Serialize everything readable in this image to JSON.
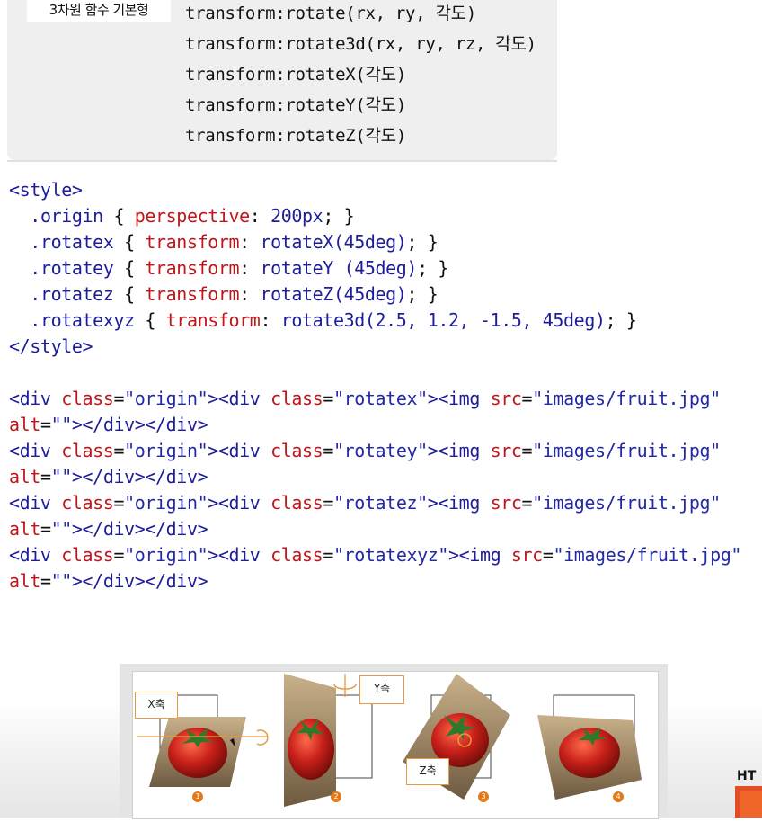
{
  "function_table": {
    "label": "3차원 함수 기본형",
    "lines": [
      "transform:rotate(rx, ry, 각도)",
      "transform:rotate3d(rx, ry, rz, 각도)",
      "transform:rotateX(각도)",
      "transform:rotateY(각도)",
      "transform:rotateZ(각도)"
    ]
  },
  "style_block": {
    "open": "<style>",
    "close": "</style>",
    "rules": [
      {
        "selector": ".origin",
        "property": "perspective",
        "value": "200px",
        "rest": "; }"
      },
      {
        "selector": ".rotatex",
        "property": "transform",
        "value": "rotateX(45deg)",
        "rest": "; }"
      },
      {
        "selector": ".rotatey",
        "property": "transform",
        "value": "rotateY (45deg)",
        "rest": "; }"
      },
      {
        "selector": ".rotatez",
        "property": "transform",
        "value": "rotateZ(45deg)",
        "rest": "; }"
      },
      {
        "selector": ".rotatexyz",
        "property": "transform",
        "value": "rotate3d(2.5, 1.2, -1.5, 45deg)",
        "rest": "; }"
      }
    ]
  },
  "html_block": {
    "divs": [
      {
        "outer_class": "\"origin\"",
        "inner_class": "\"rotatex\"",
        "src": "\"images/fruit.jpg\"",
        "alt": "\"\""
      },
      {
        "outer_class": "\"origin\"",
        "inner_class": "\"rotatey\"",
        "src": "\"images/fruit.jpg\"",
        "alt": "\"\""
      },
      {
        "outer_class": "\"origin\"",
        "inner_class": "\"rotatez\"",
        "src": "\"images/fruit.jpg\"",
        "alt": "\"\""
      },
      {
        "outer_class": "\"origin\"",
        "inner_class": "\"rotatexyz\"",
        "src": "\"images/fruit.jpg\"",
        "alt": "\"\""
      }
    ]
  },
  "figure": {
    "axis_labels": [
      "X축",
      "Y축",
      "Z축"
    ],
    "numbers": [
      "1",
      "2",
      "3",
      "4"
    ],
    "colors": {
      "accent": "#e07a1a",
      "tomato": "#c8201a",
      "leaf": "#2e7a2a"
    }
  },
  "corner_logo": {
    "text": "HT"
  }
}
